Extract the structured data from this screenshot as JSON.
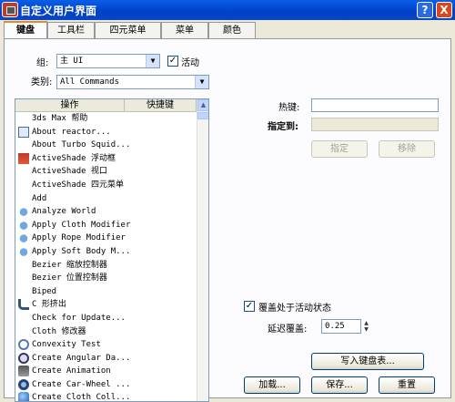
{
  "window": {
    "title": "自定义用户界面",
    "help_glyph": "?",
    "close_glyph": "X"
  },
  "tabs": [
    {
      "label": "键盘",
      "active": true
    },
    {
      "label": "工具栏"
    },
    {
      "label": "四元菜单"
    },
    {
      "label": "菜单"
    },
    {
      "label": "颜色"
    }
  ],
  "group": {
    "label": "组:",
    "value": "主 UI",
    "active_label": "活动",
    "active_checked": true
  },
  "category": {
    "label": "类别:",
    "value": "All Commands"
  },
  "list": {
    "col_action": "操作",
    "col_shortcut": "快捷键",
    "rows": [
      {
        "text": "3ds Max 帮助",
        "icon": ""
      },
      {
        "text": "About reactor...",
        "icon": "teapot-icon"
      },
      {
        "text": "About Turbo Squid...",
        "icon": ""
      },
      {
        "text": "ActiveShade 浮动框",
        "icon": "activeshade-icon"
      },
      {
        "text": "ActiveShade 视口",
        "icon": ""
      },
      {
        "text": "ActiveShade 四元菜单",
        "icon": ""
      },
      {
        "text": "Add",
        "icon": ""
      },
      {
        "text": "Analyze World",
        "icon": "teapot-icon"
      },
      {
        "text": "Apply Cloth Modifier",
        "icon": "teapot-icon"
      },
      {
        "text": "Apply Rope Modifier",
        "icon": "teapot-icon"
      },
      {
        "text": "Apply Soft Body M...",
        "icon": "teapot-icon"
      },
      {
        "text": "Bezier 缩放控制器",
        "icon": ""
      },
      {
        "text": "Bezier 位置控制器",
        "icon": ""
      },
      {
        "text": "Biped",
        "icon": ""
      },
      {
        "text": "C 形挤出",
        "icon": "c-extrude-icon"
      },
      {
        "text": "Check for Update...",
        "icon": ""
      },
      {
        "text": "Cloth 修改器",
        "icon": ""
      },
      {
        "text": "Convexity Test",
        "icon": "convexity-icon"
      },
      {
        "text": "Create Angular Da...",
        "icon": "angular-damper-icon"
      },
      {
        "text": "Create Animation",
        "icon": "animation-icon"
      },
      {
        "text": "Create Car-Wheel ...",
        "icon": "car-wheel-icon"
      },
      {
        "text": "Create Cloth Coll...",
        "icon": "cloth-collection-icon"
      }
    ]
  },
  "hotkey": {
    "label": "热键:",
    "value": ""
  },
  "assigned": {
    "label": "指定到:",
    "value": ""
  },
  "buttons": {
    "assign": "指定",
    "remove": "移除",
    "write": "写入键盘表...",
    "load": "加载...",
    "save": "保存...",
    "reset": "重置"
  },
  "override": {
    "label": "覆盖处于活动状态",
    "checked": true,
    "delay_label": "延迟覆盖:",
    "delay_value": "0.25"
  }
}
